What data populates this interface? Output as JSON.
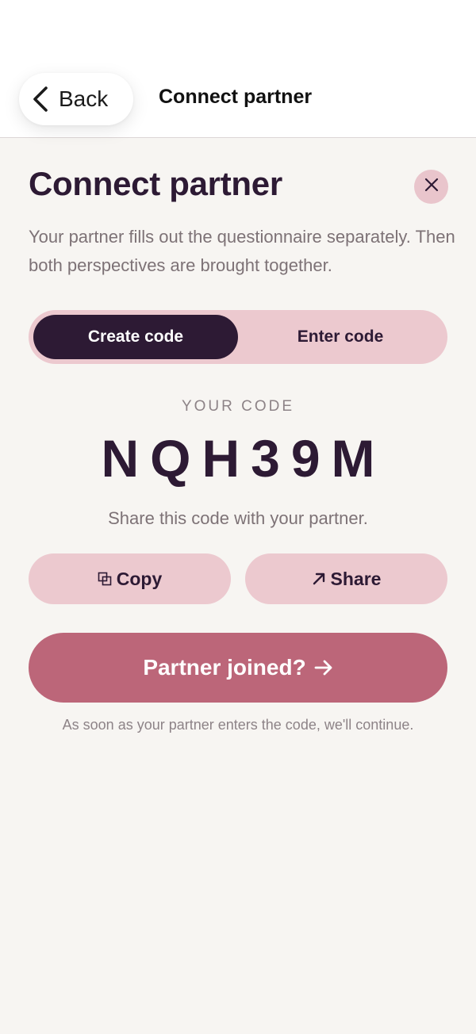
{
  "nav": {
    "back_label": "Back",
    "title": "Connect partner"
  },
  "header": {
    "title": "Connect partner",
    "subtitle": "Your partner fills out the questionnaire separately. Then both perspectives are brought together."
  },
  "tabs": [
    {
      "label": "Create code",
      "selected": true
    },
    {
      "label": "Enter code",
      "selected": false
    }
  ],
  "code": {
    "label": "YOUR CODE",
    "value": "NQH39M",
    "hint": "Share this code with your partner."
  },
  "actions": {
    "copy_label": "Copy",
    "share_label": "Share",
    "primary_label": "Partner joined?"
  },
  "footer": {
    "note": "As soon as your partner enters the code, we'll continue."
  },
  "icons": {
    "back": "chevron-left-icon",
    "close": "close-icon",
    "copy": "copy-icon",
    "share": "arrow-up-right-icon",
    "continue": "arrow-right-icon"
  },
  "colors": {
    "primary_dark": "#2d1a34",
    "accent_pink": "#bc6679",
    "soft_pink": "#ecc9cf",
    "background": "#f7f5f2"
  }
}
